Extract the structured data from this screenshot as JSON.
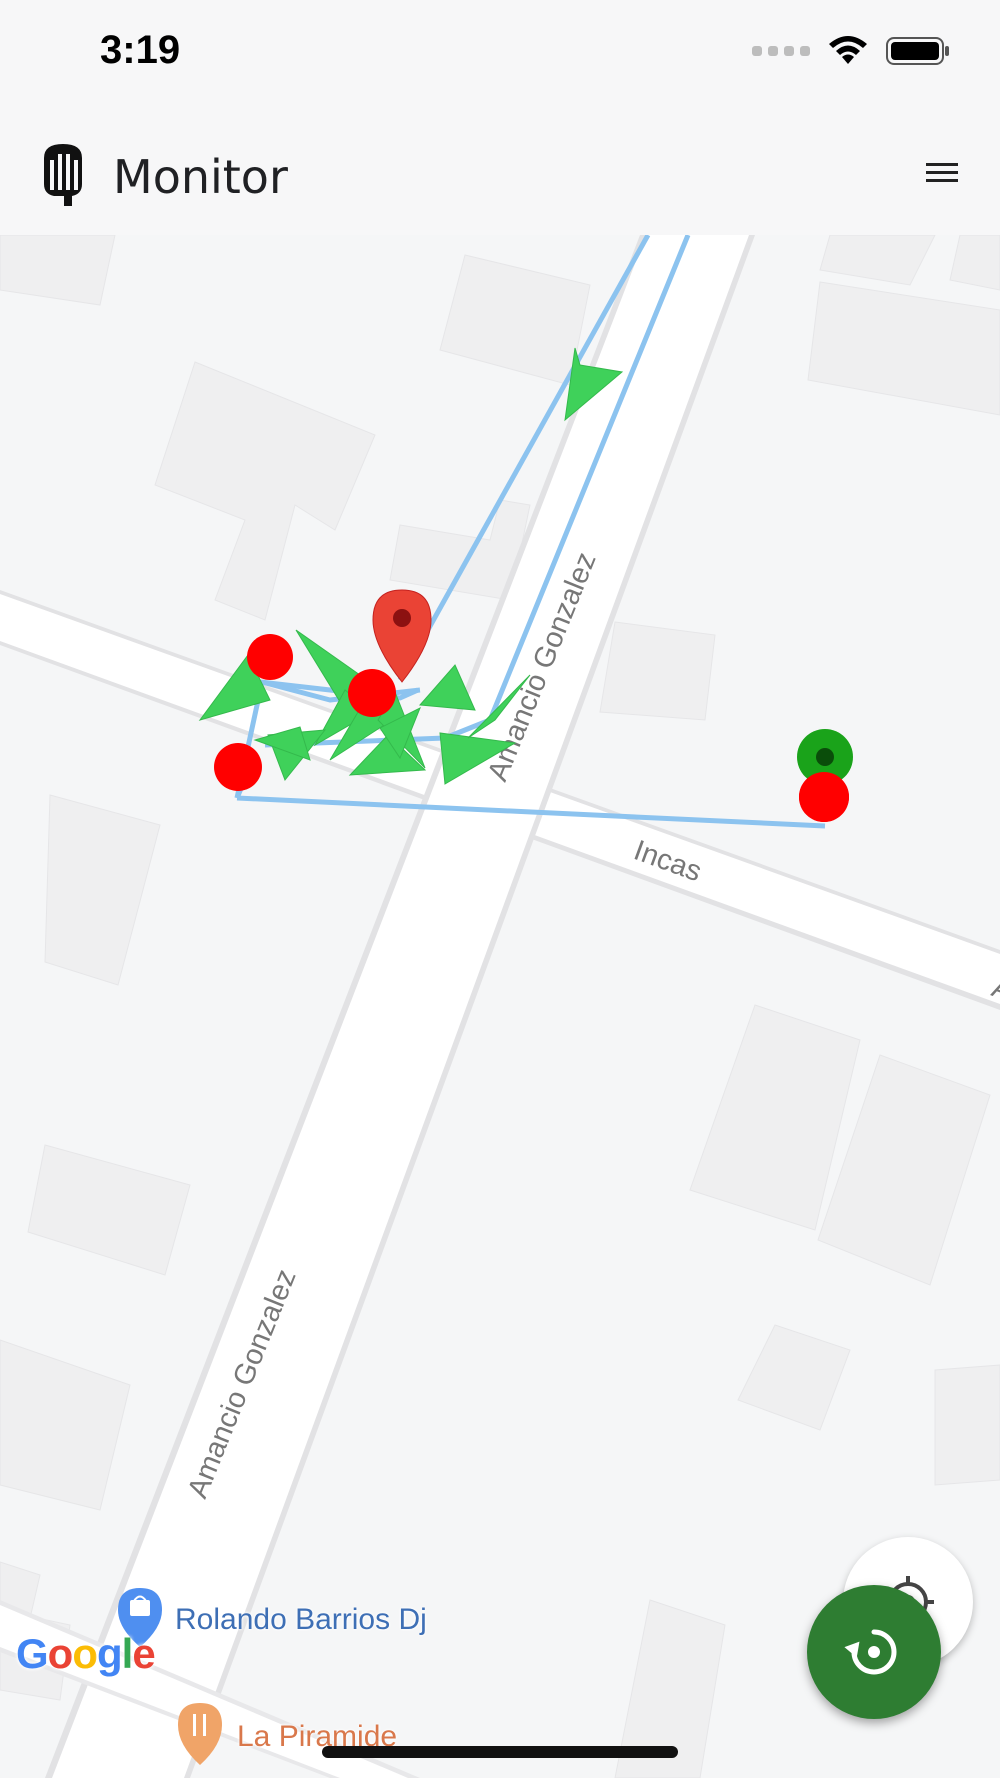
{
  "status_bar": {
    "time": "3:19",
    "icons": [
      "cellular-signal-icon",
      "wifi-icon",
      "battery-icon"
    ]
  },
  "app_bar": {
    "title": "Monitor",
    "logo_icon": "hand-logo-icon",
    "menu_icon": "hamburger-menu-icon"
  },
  "map": {
    "streets": {
      "amancio_top": "Amancio Gonzalez",
      "amancio_bottom": "Amancio Gonzalez",
      "incas": "Incas",
      "edge_letter": "A"
    },
    "pois": {
      "rolando": "Rolando Barrios Dj",
      "piramide": "La Piramide"
    },
    "attribution": "Google",
    "colors": {
      "route": "#8cc3ef",
      "arrow": "#3fd15a",
      "stop_marker": "#ff0000",
      "start_marker": "#1aa31a",
      "pin": "#ea4335",
      "fab": "#2e7d32"
    }
  },
  "fab": {
    "primary_icon": "history-replay-icon",
    "secondary_icon": "my-location-icon"
  }
}
